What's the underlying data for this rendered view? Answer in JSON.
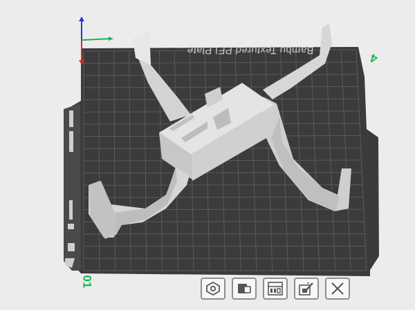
{
  "plate": {
    "label": "Bambu Textured PEI Plate",
    "number_top": "4",
    "number_bottom": "01"
  },
  "toolbar": {
    "buttons": [
      {
        "name": "orient-icon"
      },
      {
        "name": "arrange-icon"
      },
      {
        "name": "layout-icon"
      },
      {
        "name": "edit-icon"
      },
      {
        "name": "close-icon"
      }
    ]
  },
  "colors": {
    "plate": "#3b3b3b",
    "grid": "#5e5e5e",
    "model": "#dcdcdc",
    "axis_x": "#19b54a",
    "axis_y": "#d62a2a",
    "axis_z": "#2737c9",
    "plate_number": "#19b54a"
  }
}
